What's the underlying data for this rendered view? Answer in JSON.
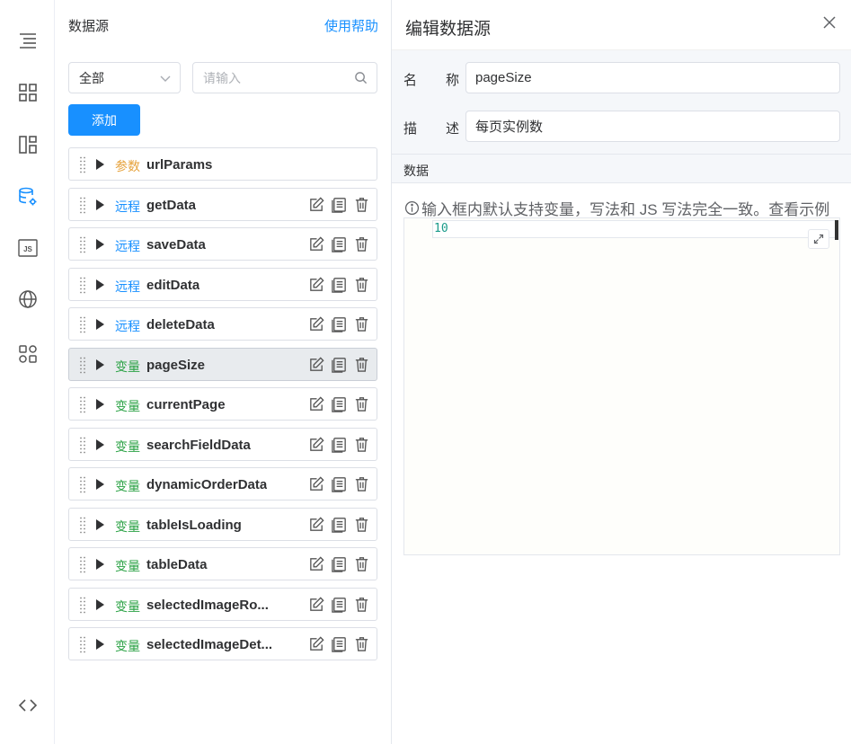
{
  "rail": {
    "items": [
      "outline-icon",
      "grid-icon",
      "layout-icon",
      "database-settings-icon",
      "js-icon",
      "globe-icon",
      "components-icon"
    ],
    "bottom": "code-icon",
    "active_color": "#1890ff"
  },
  "panel": {
    "title": "数据源",
    "help": "使用帮助",
    "filter_value": "全部",
    "search_placeholder": "请输入",
    "add_label": "添加"
  },
  "datasources": [
    {
      "tag": "参数",
      "kind": "param",
      "name": "urlParams",
      "actions": false
    },
    {
      "tag": "远程",
      "kind": "remote",
      "name": "getData",
      "actions": true
    },
    {
      "tag": "远程",
      "kind": "remote",
      "name": "saveData",
      "actions": true
    },
    {
      "tag": "远程",
      "kind": "remote",
      "name": "editData",
      "actions": true
    },
    {
      "tag": "远程",
      "kind": "remote",
      "name": "deleteData",
      "actions": true
    },
    {
      "tag": "变量",
      "kind": "var",
      "name": "pageSize",
      "actions": true,
      "selected": true
    },
    {
      "tag": "变量",
      "kind": "var",
      "name": "currentPage",
      "actions": true
    },
    {
      "tag": "变量",
      "kind": "var",
      "name": "searchFieldData",
      "actions": true
    },
    {
      "tag": "变量",
      "kind": "var",
      "name": "dynamicOrderData",
      "actions": true
    },
    {
      "tag": "变量",
      "kind": "var",
      "name": "tableIsLoading",
      "actions": true
    },
    {
      "tag": "变量",
      "kind": "var",
      "name": "tableData",
      "actions": true
    },
    {
      "tag": "变量",
      "kind": "var",
      "name": "selectedImageRo...",
      "actions": true
    },
    {
      "tag": "变量",
      "kind": "var",
      "name": "selectedImageDet...",
      "actions": true
    }
  ],
  "editor": {
    "title": "编辑数据源",
    "name_label_1": "名",
    "name_label_2": "称",
    "name_value": "pageSize",
    "desc_label_1": "描",
    "desc_label_2": "述",
    "desc_value": "每页实例数",
    "data_label": "数据",
    "hint": "输入框内默认支持变量，写法和 JS 写法完全一致。查看示例",
    "code": "10"
  }
}
